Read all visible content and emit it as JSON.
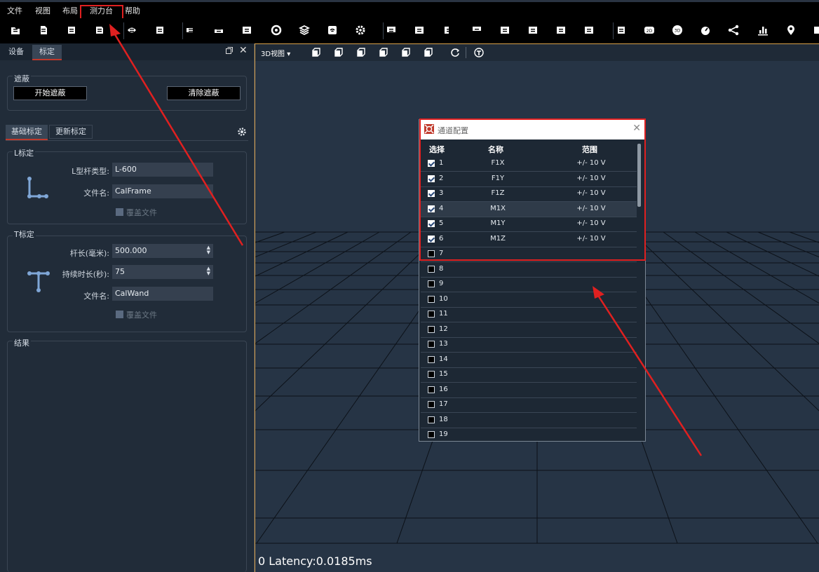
{
  "menu": {
    "items": [
      "文件",
      "视图",
      "布局",
      "测力台",
      "帮助"
    ]
  },
  "toolbar_icons": [
    "open-folder-icon",
    "document-icon",
    "save-icon",
    "save-as-icon",
    "hide-eye-icon",
    "switch-icon",
    "camera-icon",
    "device-icon",
    "film-icon",
    "target-icon",
    "layers-icon",
    "wifi-icon",
    "settings-icon",
    "monitor-icon",
    "layout-icon",
    "layout2-icon",
    "layout3-icon",
    "layout4-icon",
    "layout5-icon",
    "layout6-icon",
    "layout7-icon",
    "capture-icon",
    "2d-icon",
    "3d-icon",
    "gauge-icon",
    "graph-icon",
    "bar-chart-icon",
    "location-icon",
    "more-icon"
  ],
  "left_panel": {
    "tabs": [
      "设备",
      "标定"
    ],
    "mask": {
      "title": "遮蔽",
      "start_button": "开始遮蔽",
      "clear_button": "清除遮蔽"
    },
    "subtabs": [
      "基础标定",
      "更新标定"
    ],
    "l_calib": {
      "title": "L标定",
      "type_label": "L型杆类型:",
      "type_value": "L-600",
      "file_label": "文件名:",
      "file_value": "CalFrame",
      "overwrite": "覆盖文件"
    },
    "t_calib": {
      "title": "T标定",
      "length_label": "杆长(毫米):",
      "length_value": "500.000",
      "duration_label": "持续时长(秒):",
      "duration_value": "75",
      "file_label": "文件名:",
      "file_value": "CalWand",
      "overwrite": "覆盖文件"
    },
    "result_title": "结果"
  },
  "viewport": {
    "view_select": "3D视图",
    "latency": "0 Latency:0.0185ms"
  },
  "dialog": {
    "title": "通道配置",
    "headers": {
      "select": "选择",
      "name": "名称",
      "range": "范围"
    },
    "rows": [
      {
        "idx": "1",
        "checked": true,
        "name": "F1X",
        "range": "+/- 10 V"
      },
      {
        "idx": "2",
        "checked": true,
        "name": "F1Y",
        "range": "+/- 10 V"
      },
      {
        "idx": "3",
        "checked": true,
        "name": "F1Z",
        "range": "+/- 10 V"
      },
      {
        "idx": "4",
        "checked": true,
        "name": "M1X",
        "range": "+/- 10 V"
      },
      {
        "idx": "5",
        "checked": true,
        "name": "M1Y",
        "range": "+/- 10 V"
      },
      {
        "idx": "6",
        "checked": true,
        "name": "M1Z",
        "range": "+/- 10 V"
      },
      {
        "idx": "7",
        "checked": false,
        "name": "",
        "range": ""
      },
      {
        "idx": "8",
        "checked": false,
        "name": "",
        "range": ""
      },
      {
        "idx": "9",
        "checked": false,
        "name": "",
        "range": ""
      },
      {
        "idx": "10",
        "checked": false,
        "name": "",
        "range": ""
      },
      {
        "idx": "11",
        "checked": false,
        "name": "",
        "range": ""
      },
      {
        "idx": "12",
        "checked": false,
        "name": "",
        "range": ""
      },
      {
        "idx": "13",
        "checked": false,
        "name": "",
        "range": ""
      },
      {
        "idx": "14",
        "checked": false,
        "name": "",
        "range": ""
      },
      {
        "idx": "15",
        "checked": false,
        "name": "",
        "range": ""
      },
      {
        "idx": "16",
        "checked": false,
        "name": "",
        "range": ""
      },
      {
        "idx": "17",
        "checked": false,
        "name": "",
        "range": ""
      },
      {
        "idx": "18",
        "checked": false,
        "name": "",
        "range": ""
      },
      {
        "idx": "19",
        "checked": false,
        "name": "",
        "range": ""
      }
    ]
  },
  "colors": {
    "highlight": "#e02020",
    "accent_tab": "#c0392b",
    "viewport_border": "#d9a24a"
  }
}
